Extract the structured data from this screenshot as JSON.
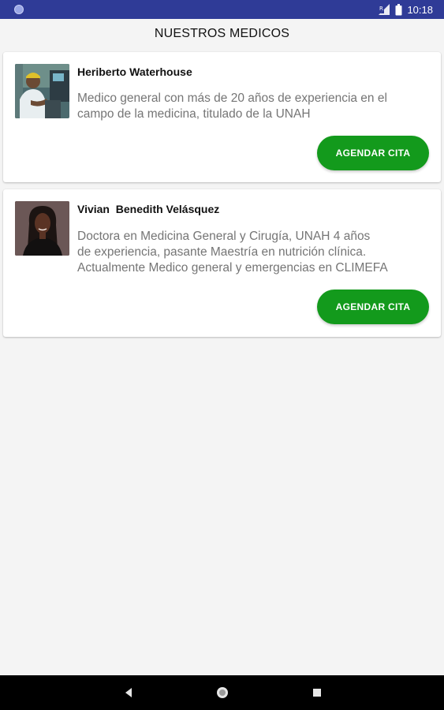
{
  "status_bar": {
    "time": "10:18",
    "icons": [
      "notification-dot-icon",
      "signal-icon",
      "battery-icon"
    ]
  },
  "app": {
    "title": "NUESTROS MEDICOS"
  },
  "doctors": [
    {
      "name": "Heriberto Waterhouse",
      "description_lines": [
        "Medico general con más de 20 años de experiencia en el",
        "campo de la medicina, titulado de la UNAH"
      ],
      "button_label": "AGENDAR CITA"
    },
    {
      "name": "Vivian  Benedith Velásquez",
      "description_lines": [
        "Doctora en Medicina General y Cirugía, UNAH 4 años",
        "de experiencia, pasante Maestría en nutrición clínica.",
        "Actualmente Medico general y emergencias en CLIMEFA"
      ],
      "button_label": "AGENDAR CITA"
    }
  ],
  "nav_bar": {
    "icons": [
      "back-icon",
      "home-icon",
      "recents-icon"
    ]
  },
  "colors": {
    "status_bar": "#2f3b97",
    "accent_button": "#139a1c",
    "background": "#f4f4f4"
  }
}
